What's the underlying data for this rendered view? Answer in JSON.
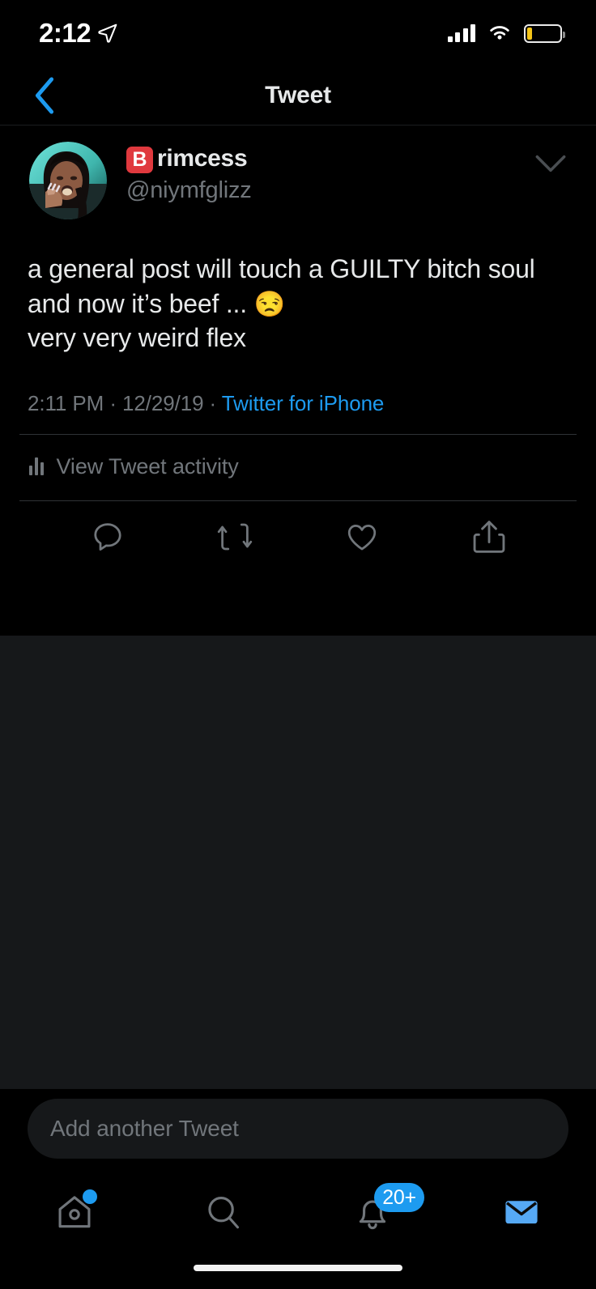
{
  "status_bar": {
    "time": "2:12",
    "location_icon": "location-arrow-icon",
    "signal_icon": "cellular-signal-icon",
    "wifi_icon": "wifi-icon",
    "battery_icon": "battery-low-icon",
    "battery_level_percent": 15,
    "battery_color": "#f5c518"
  },
  "nav": {
    "back_icon": "chevron-left-icon",
    "title": "Tweet",
    "accent_color": "#1d9bf0"
  },
  "tweet": {
    "avatar": "user-avatar",
    "display_name_emoji": "B",
    "display_name": "rimcess",
    "handle": "@niymfglizz",
    "caret_icon": "chevron-down-icon",
    "text": "a general post will touch a GUILTY bitch soul and now it’s beef ... ",
    "text_emoji": "😒",
    "text_line2": "very very weird flex",
    "time": "2:11 PM",
    "separator_1": " · ",
    "date": "12/29/19",
    "separator_2": " · ",
    "source": "Twitter for iPhone",
    "activity_icon": "analytics-bars-icon",
    "activity_label": "View Tweet activity",
    "actions": [
      {
        "name": "reply-icon",
        "label": "Reply",
        "count": ""
      },
      {
        "name": "retweet-icon",
        "label": "Retweet",
        "count": ""
      },
      {
        "name": "like-icon",
        "label": "Like",
        "count": ""
      },
      {
        "name": "share-icon",
        "label": "Share",
        "count": ""
      }
    ]
  },
  "compose": {
    "placeholder": "Add another Tweet"
  },
  "tabbar": {
    "items": [
      {
        "name": "tab-home",
        "icon": "home-icon",
        "badge": "",
        "badge_type": "dot",
        "active": false
      },
      {
        "name": "tab-search",
        "icon": "search-icon",
        "badge": "",
        "badge_type": "none",
        "active": false
      },
      {
        "name": "tab-notifications",
        "icon": "bell-icon",
        "badge": "20+",
        "badge_type": "count",
        "active": false
      },
      {
        "name": "tab-messages",
        "icon": "envelope-icon",
        "badge": "",
        "badge_type": "none",
        "active": true
      }
    ]
  },
  "theme": {
    "background": "#000000",
    "surface": "#16181a",
    "text_primary": "#e7e9ea",
    "text_secondary": "#71767b",
    "accent": "#1d9bf0",
    "divider": "#2f3336"
  }
}
